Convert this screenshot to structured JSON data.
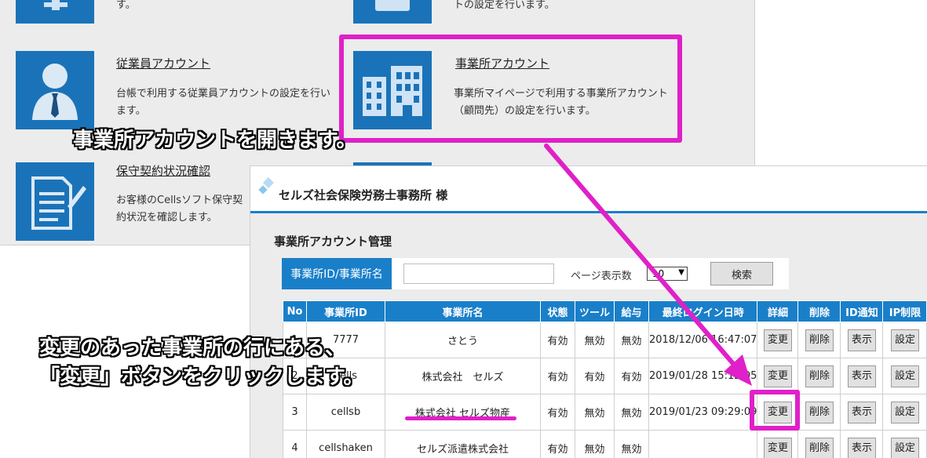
{
  "menu": {
    "top_left_desc": "す。",
    "top_right_desc": "トの設定を行います。",
    "employee": {
      "title": "従業員アカウント",
      "desc": "台帳で利用する従業員アカウントの設定を行います。"
    },
    "office": {
      "title": "事業所アカウント",
      "desc": "事業所マイページで利用する事業所アカウント（顧問先）の設定を行います。"
    },
    "contract": {
      "title": "保守契約状況確認",
      "desc": "お客様のCellsソフト保守契約状況を確認します。"
    }
  },
  "panel": {
    "office_name": "セルズ社会保険労務士事務所 様",
    "section_title": "事業所アカウント管理",
    "search_label": "事業所ID/事業所名",
    "search_value": "",
    "page_size_label": "ページ表示数",
    "page_size_value": "10",
    "search_button": "検索"
  },
  "table": {
    "headers": [
      "No",
      "事業所ID",
      "事業所名",
      "状態",
      "ツール",
      "給与",
      "最終ログイン日時",
      "詳細",
      "削除",
      "ID通知",
      "IP制限"
    ],
    "rows": [
      {
        "no": "1",
        "id": "7777",
        "name": "さとう",
        "status": "有効",
        "tool": "無効",
        "salary": "無効",
        "last_login": "2018/12/06 16:47:07"
      },
      {
        "no": "2",
        "id": "cells",
        "name": "株式会社　セルズ",
        "status": "有効",
        "tool": "有効",
        "salary": "有効",
        "last_login": "2019/01/28 15:12:05"
      },
      {
        "no": "3",
        "id": "cellsb",
        "name": "株式会社 セルズ物産",
        "status": "有効",
        "tool": "無効",
        "salary": "無効",
        "last_login": "2019/01/23 09:29:09"
      },
      {
        "no": "4",
        "id": "cellshaken",
        "name": "セルズ派遣株式会社",
        "status": "有効",
        "tool": "無効",
        "salary": "無効",
        "last_login": ""
      }
    ],
    "btn_change": "変更",
    "btn_delete": "削除",
    "btn_show": "表示",
    "btn_setting": "設定"
  },
  "annotations": {
    "callout_open": "事業所アカウントを開きます。",
    "callout_click_line1": "変更のあった事業所の行にある、",
    "callout_click_line2": "「変更」ボタンをクリックします。",
    "highlight_color": "#e020c8"
  },
  "colors": {
    "accent": "#1a7fc9",
    "tile": "#1a73b9"
  },
  "icons": [
    "plus-icon",
    "folder-icon",
    "person-icon",
    "office-building-icon",
    "document-pen-icon",
    "diamond-logo-icon"
  ]
}
